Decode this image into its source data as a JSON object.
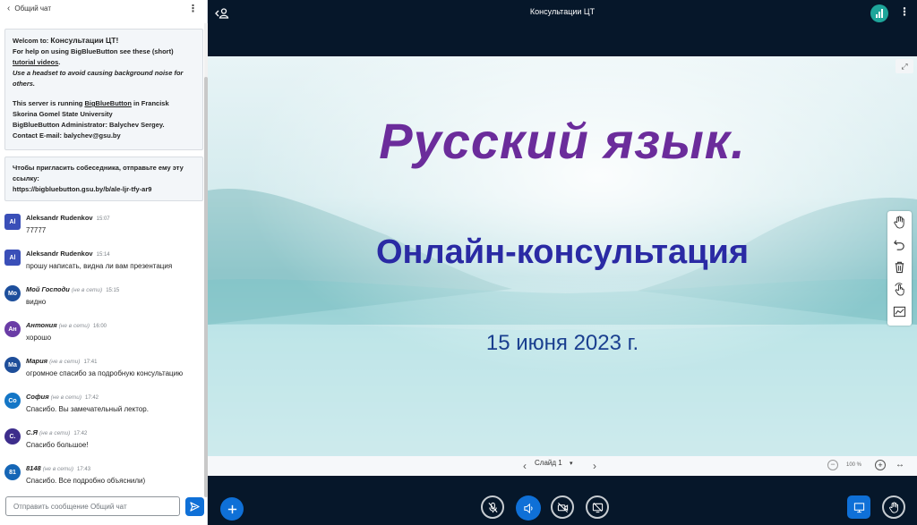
{
  "chat": {
    "header_title": "Общий чат",
    "welcome": {
      "line1_prefix": "Welcom to:",
      "room_name": "Консультации ЦТ",
      "line1_suffix": "!",
      "help_text": "For help on using BigBlueButton see these (short)",
      "tutorial_link": "tutorial videos",
      "headset_note": "Use a headset to avoid causing background noise for others.",
      "server_prefix": "This server is running",
      "bbb_link": "BigBlueButton",
      "server_suffix": "in Francisk Skorina Gomel State University",
      "admin": "BigBlueButton Administrator: Balychev Sergey.",
      "contact": "Contact E-mail: balychev@gsu.by"
    },
    "invite": {
      "text": "Чтобы пригласить собеседника, отправьте ему эту ссылку:",
      "link": "https://bigbluebutton.gsu.by/b/ale-ljr-tfy-ar9"
    },
    "offline_label": "(не в сети)",
    "messages": [
      {
        "avatar": "Al",
        "name": "Aleksandr Rudenkov",
        "time": "15:07",
        "text": "77777",
        "color": "#3a4fb8",
        "offline": false
      },
      {
        "avatar": "Al",
        "name": "Aleksandr Rudenkov",
        "time": "15:14",
        "text": "прошу написать, видна ли вам презентация",
        "color": "#3a4fb8",
        "offline": false
      },
      {
        "avatar": "Мо",
        "name": "Мой Господи",
        "time": "15:15",
        "text": "видно",
        "color": "#1d4f9c",
        "offline": true
      },
      {
        "avatar": "Ан",
        "name": "Антония",
        "time": "16:00",
        "text": "хорошо",
        "color": "#6a3ca6",
        "offline": true
      },
      {
        "avatar": "Ма",
        "name": "Мария",
        "time": "17:41",
        "text": "огромное спасибо за подробную консультацию",
        "color": "#1e4e9a",
        "offline": true
      },
      {
        "avatar": "Со",
        "name": "София",
        "time": "17:42",
        "text": "Спасибо. Вы замечательный лектор.",
        "color": "#1476c6",
        "offline": true
      },
      {
        "avatar": "С.",
        "name": "С.Я",
        "time": "17:42",
        "text": "Спасибо большое!",
        "color": "#3d2d8c",
        "offline": true
      },
      {
        "avatar": "81",
        "name": "8148",
        "time": "17:43",
        "text": "Спасибо. Все подробно объяснили)",
        "color": "#1566b6",
        "offline": true
      }
    ],
    "input_placeholder": "Отправить сообщение Общий чат"
  },
  "topbar": {
    "title": "Консультации ЦТ"
  },
  "slide": {
    "title": "Русский  язык.",
    "subtitle": "Онлайн-консультация",
    "date": "15 июня  2023 г."
  },
  "slide_controls": {
    "current_slide": "Слайд 1",
    "zoom": "100 %"
  },
  "icons": {
    "toolbar": [
      "hand-icon",
      "undo-icon",
      "trash-icon",
      "multi-user-pointer-icon",
      "chart-icon"
    ],
    "bottom": [
      "plus-icon",
      "mic-muted-icon",
      "speaker-icon",
      "camera-off-icon",
      "screenshare-off-icon",
      "presentation-icon",
      "raise-hand-icon"
    ]
  },
  "colors": {
    "accent": "#0f70d7",
    "background": "#06172a",
    "connection": "#1ea59a"
  }
}
